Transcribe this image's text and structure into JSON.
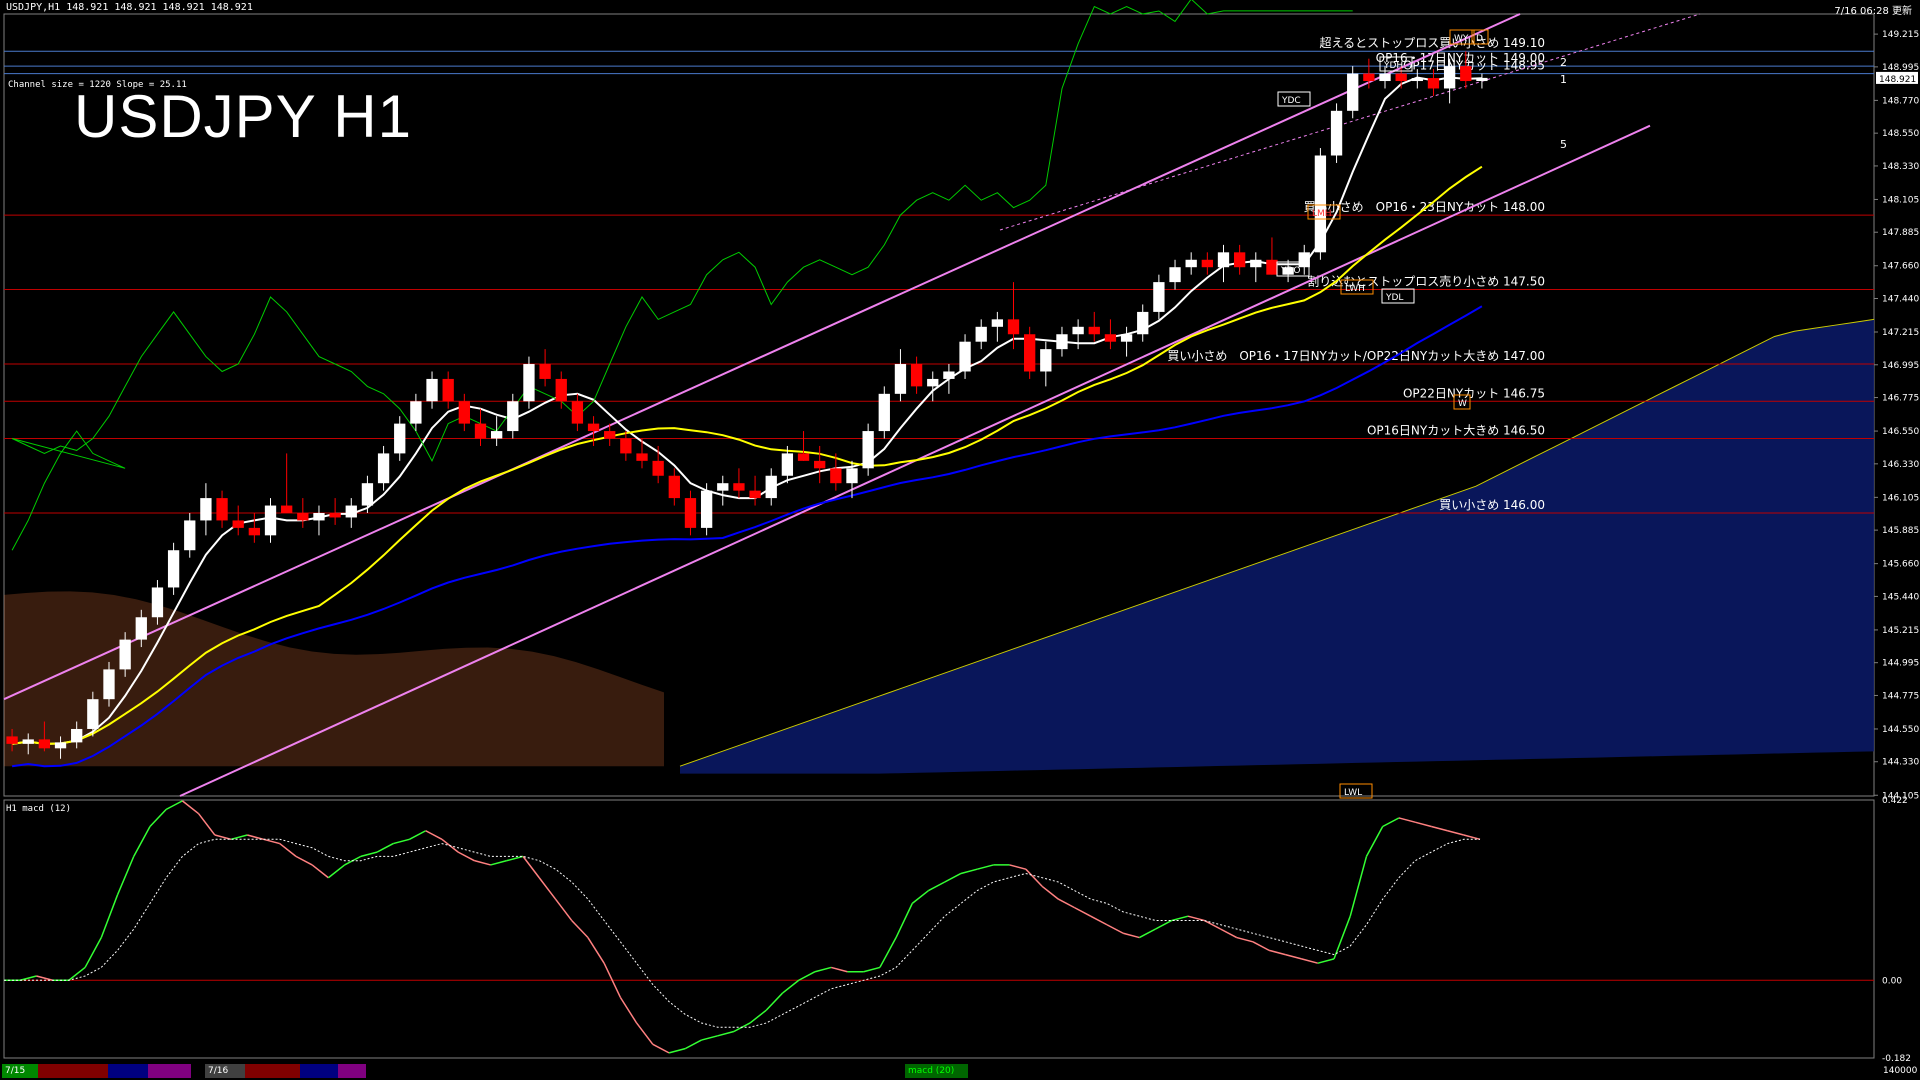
{
  "window": {
    "title": "USDJPY,H1  148.921 148.921 148.921 148.921",
    "clock": "7/16 06:28 更新"
  },
  "chart_title": "USDJPY H1",
  "channel_info": "Channel size = 1220 Slope = 25.11",
  "colors": {
    "background": "#000000",
    "bull_candle": "#ffffff",
    "bear_candle": "#ff0000",
    "channel": "#ee82ee",
    "ma_short": "#ffffff",
    "ma_mid": "#ffff00",
    "ma_long": "#0000ff",
    "chikou": "#00cc00",
    "cloud_bear": "#ff8040",
    "cloud_bull": "#3050ff",
    "bollinger": "#cc0000",
    "level_line": "#c00000",
    "macd_up": "#33ff33",
    "macd_down": "#ff8080",
    "macd_signal": "#ffffff"
  },
  "chart_data": [
    {
      "type": "candlestick",
      "symbol": "USDJPY",
      "timeframe": "H1",
      "ylim": [
        144.1,
        149.35
      ],
      "y_ticks": [
        "149.215",
        "148.995",
        "148.770",
        "148.550",
        "148.330",
        "148.105",
        "147.885",
        "147.660",
        "147.440",
        "147.215",
        "146.995",
        "146.775",
        "146.550",
        "146.330",
        "146.105",
        "145.885",
        "145.660",
        "145.440",
        "145.215",
        "144.995",
        "144.775",
        "144.550",
        "144.330",
        "144.105"
      ],
      "current_price": "148.921",
      "x_labels": [
        "7/15",
        "7/16"
      ],
      "candles": [
        [
          144.5,
          144.55,
          144.4,
          144.45
        ],
        [
          144.45,
          144.52,
          144.38,
          144.48
        ],
        [
          144.48,
          144.6,
          144.4,
          144.42
        ],
        [
          144.42,
          144.5,
          144.35,
          144.46
        ],
        [
          144.46,
          144.6,
          144.42,
          144.55
        ],
        [
          144.55,
          144.8,
          144.5,
          144.75
        ],
        [
          144.75,
          145.0,
          144.7,
          144.95
        ],
        [
          144.95,
          145.2,
          144.9,
          145.15
        ],
        [
          145.15,
          145.35,
          145.1,
          145.3
        ],
        [
          145.3,
          145.55,
          145.25,
          145.5
        ],
        [
          145.5,
          145.8,
          145.45,
          145.75
        ],
        [
          145.75,
          146.0,
          145.7,
          145.95
        ],
        [
          145.95,
          146.2,
          145.85,
          146.1
        ],
        [
          146.1,
          146.15,
          145.9,
          145.95
        ],
        [
          145.95,
          146.05,
          145.85,
          145.9
        ],
        [
          145.9,
          146.0,
          145.8,
          145.85
        ],
        [
          145.85,
          146.1,
          145.8,
          146.05
        ],
        [
          146.05,
          146.4,
          146.0,
          146.0
        ],
        [
          146.0,
          146.1,
          145.9,
          145.95
        ],
        [
          145.95,
          146.05,
          145.85,
          146.0
        ],
        [
          146.0,
          146.1,
          145.92,
          145.97
        ],
        [
          145.97,
          146.1,
          145.9,
          146.05
        ],
        [
          146.05,
          146.25,
          146.0,
          146.2
        ],
        [
          146.2,
          146.45,
          146.15,
          146.4
        ],
        [
          146.4,
          146.65,
          146.35,
          146.6
        ],
        [
          146.6,
          146.8,
          146.55,
          146.75
        ],
        [
          146.75,
          146.95,
          146.7,
          146.9
        ],
        [
          146.9,
          146.95,
          146.7,
          146.75
        ],
        [
          146.75,
          146.8,
          146.55,
          146.6
        ],
        [
          146.6,
          146.7,
          146.45,
          146.5
        ],
        [
          146.5,
          146.65,
          146.45,
          146.55
        ],
        [
          146.55,
          146.8,
          146.5,
          146.75
        ],
        [
          146.75,
          147.05,
          146.7,
          147.0
        ],
        [
          147.0,
          147.1,
          146.85,
          146.9
        ],
        [
          146.9,
          146.95,
          146.7,
          146.75
        ],
        [
          146.75,
          146.8,
          146.55,
          146.6
        ],
        [
          146.6,
          146.65,
          146.45,
          146.55
        ],
        [
          146.55,
          146.6,
          146.45,
          146.5
        ],
        [
          146.5,
          146.55,
          146.35,
          146.4
        ],
        [
          146.4,
          146.5,
          146.3,
          146.35
        ],
        [
          146.35,
          146.45,
          146.2,
          146.25
        ],
        [
          146.25,
          146.3,
          146.05,
          146.1
        ],
        [
          146.1,
          146.15,
          145.85,
          145.9
        ],
        [
          145.9,
          146.2,
          145.85,
          146.15
        ],
        [
          146.15,
          146.25,
          146.05,
          146.2
        ],
        [
          146.2,
          146.3,
          146.1,
          146.15
        ],
        [
          146.15,
          146.25,
          146.05,
          146.1
        ],
        [
          146.1,
          146.3,
          146.05,
          146.25
        ],
        [
          146.25,
          146.45,
          146.2,
          146.4
        ],
        [
          146.4,
          146.55,
          146.35,
          146.35
        ],
        [
          146.35,
          146.45,
          146.2,
          146.3
        ],
        [
          146.3,
          146.4,
          146.15,
          146.2
        ],
        [
          146.2,
          146.35,
          146.1,
          146.3
        ],
        [
          146.3,
          146.6,
          146.25,
          146.55
        ],
        [
          146.55,
          146.85,
          146.5,
          146.8
        ],
        [
          146.8,
          147.1,
          146.75,
          147.0
        ],
        [
          147.0,
          147.05,
          146.8,
          146.85
        ],
        [
          146.85,
          146.95,
          146.75,
          146.9
        ],
        [
          146.9,
          147.0,
          146.8,
          146.95
        ],
        [
          146.95,
          147.2,
          146.9,
          147.15
        ],
        [
          147.15,
          147.3,
          147.1,
          147.25
        ],
        [
          147.25,
          147.35,
          147.15,
          147.3
        ],
        [
          147.3,
          147.55,
          147.1,
          147.2
        ],
        [
          147.2,
          147.25,
          146.9,
          146.95
        ],
        [
          146.95,
          147.15,
          146.85,
          147.1
        ],
        [
          147.1,
          147.25,
          147.05,
          147.2
        ],
        [
          147.2,
          147.3,
          147.1,
          147.25
        ],
        [
          147.25,
          147.35,
          147.15,
          147.2
        ],
        [
          147.2,
          147.3,
          147.1,
          147.15
        ],
        [
          147.15,
          147.25,
          147.05,
          147.2
        ],
        [
          147.2,
          147.4,
          147.15,
          147.35
        ],
        [
          147.35,
          147.6,
          147.3,
          147.55
        ],
        [
          147.55,
          147.7,
          147.5,
          147.65
        ],
        [
          147.65,
          147.75,
          147.6,
          147.7
        ],
        [
          147.7,
          147.75,
          147.6,
          147.65
        ],
        [
          147.65,
          147.8,
          147.55,
          147.75
        ],
        [
          147.75,
          147.8,
          147.6,
          147.65
        ],
        [
          147.65,
          147.75,
          147.55,
          147.7
        ],
        [
          147.7,
          147.85,
          147.6,
          147.6
        ],
        [
          147.6,
          147.7,
          147.55,
          147.65
        ],
        [
          147.65,
          147.8,
          147.6,
          147.75
        ],
        [
          147.75,
          148.45,
          147.7,
          148.4
        ],
        [
          148.4,
          148.75,
          148.35,
          148.7
        ],
        [
          148.7,
          149.0,
          148.65,
          148.95
        ],
        [
          148.95,
          149.05,
          148.85,
          148.9
        ],
        [
          148.9,
          149.0,
          148.85,
          148.95
        ],
        [
          148.95,
          149.0,
          148.85,
          148.9
        ],
        [
          148.9,
          148.98,
          148.85,
          148.92
        ],
        [
          148.92,
          148.98,
          148.8,
          148.85
        ],
        [
          148.85,
          149.05,
          148.75,
          149.0
        ],
        [
          149.0,
          149.1,
          148.85,
          148.9
        ],
        [
          148.9,
          148.95,
          148.85,
          148.921
        ]
      ],
      "annotations": [
        {
          "text": "超えるとストップロス買い小さめ 149.10",
          "price": 149.1
        },
        {
          "text": "OP16・17日NYカット 149.00",
          "price": 149.0
        },
        {
          "text": "OP17日NYカット 148.95",
          "price": 148.95
        },
        {
          "text": "買い小さめ　OP16・23日NYカット 148.00",
          "price": 148.0
        },
        {
          "text": "割り込むとストップロス売り小さめ 147.50",
          "price": 147.5
        },
        {
          "text": "買い小さめ　OP16・17日NYカット/OP22日NYカット大きめ 147.00",
          "price": 147.0
        },
        {
          "text": "OP22日NYカット 146.75",
          "price": 146.75
        },
        {
          "text": "OP16日NYカット大きめ 146.50",
          "price": 146.5
        },
        {
          "text": "買い小さめ 146.00",
          "price": 146.0
        }
      ],
      "boxes": [
        "YDH",
        "YDC",
        "YDO",
        "LMH",
        "LWH",
        "YDL",
        "LWL",
        "WY",
        "D",
        "W"
      ],
      "fib_marks": [
        "2",
        "1",
        "5"
      ]
    },
    {
      "type": "line",
      "name_label": "H1  macd (12)",
      "ylim": [
        -0.182,
        0.422
      ],
      "y_ticks": [
        "0.422",
        "0.00",
        "-0.182"
      ],
      "macd": [
        0.0,
        0.0,
        0.01,
        0.0,
        0.0,
        0.03,
        0.1,
        0.2,
        0.29,
        0.36,
        0.4,
        0.42,
        0.39,
        0.34,
        0.33,
        0.34,
        0.33,
        0.32,
        0.29,
        0.27,
        0.24,
        0.27,
        0.29,
        0.3,
        0.32,
        0.33,
        0.35,
        0.33,
        0.3,
        0.28,
        0.27,
        0.28,
        0.29,
        0.24,
        0.19,
        0.14,
        0.1,
        0.04,
        -0.04,
        -0.1,
        -0.15,
        -0.17,
        -0.16,
        -0.14,
        -0.13,
        -0.12,
        -0.1,
        -0.07,
        -0.03,
        0.0,
        0.02,
        0.03,
        0.02,
        0.02,
        0.03,
        0.1,
        0.18,
        0.21,
        0.23,
        0.25,
        0.26,
        0.27,
        0.27,
        0.26,
        0.22,
        0.19,
        0.17,
        0.15,
        0.13,
        0.11,
        0.1,
        0.12,
        0.14,
        0.15,
        0.14,
        0.12,
        0.1,
        0.09,
        0.07,
        0.06,
        0.05,
        0.04,
        0.05,
        0.15,
        0.29,
        0.36,
        0.38,
        0.37,
        0.36,
        0.35,
        0.34,
        0.33
      ],
      "signal": [
        0.0,
        0.0,
        0.0,
        0.0,
        0.0,
        0.01,
        0.03,
        0.07,
        0.12,
        0.18,
        0.24,
        0.29,
        0.32,
        0.33,
        0.33,
        0.33,
        0.33,
        0.33,
        0.32,
        0.31,
        0.29,
        0.28,
        0.28,
        0.29,
        0.29,
        0.3,
        0.31,
        0.32,
        0.31,
        0.3,
        0.29,
        0.29,
        0.29,
        0.28,
        0.26,
        0.23,
        0.19,
        0.14,
        0.09,
        0.04,
        -0.01,
        -0.05,
        -0.08,
        -0.1,
        -0.11,
        -0.11,
        -0.11,
        -0.1,
        -0.08,
        -0.06,
        -0.04,
        -0.02,
        -0.01,
        0.0,
        0.01,
        0.03,
        0.07,
        0.11,
        0.15,
        0.18,
        0.21,
        0.23,
        0.24,
        0.25,
        0.24,
        0.23,
        0.21,
        0.19,
        0.18,
        0.16,
        0.15,
        0.14,
        0.14,
        0.14,
        0.14,
        0.13,
        0.12,
        0.11,
        0.1,
        0.09,
        0.08,
        0.07,
        0.06,
        0.08,
        0.13,
        0.19,
        0.24,
        0.28,
        0.3,
        0.32,
        0.33,
        0.33
      ]
    }
  ],
  "bottom_tabs": [
    "7/15",
    "7/16",
    "macd (20)"
  ],
  "bottom_right": "140000"
}
